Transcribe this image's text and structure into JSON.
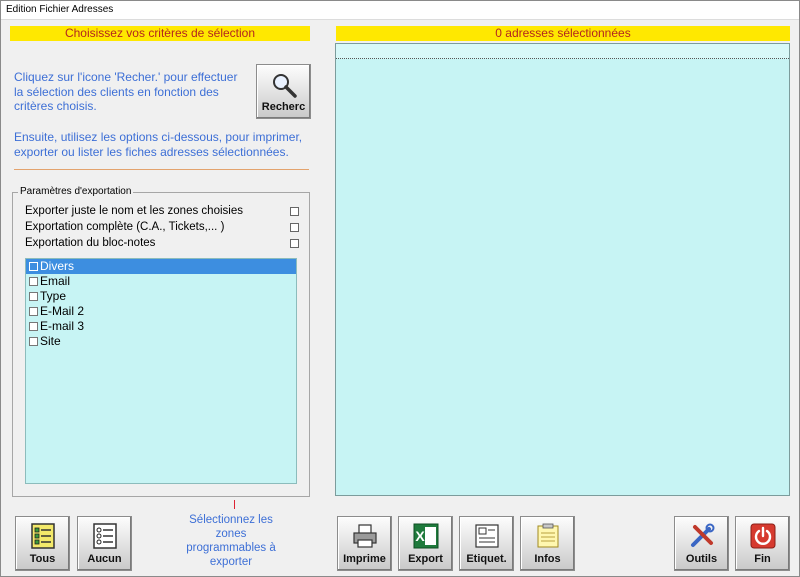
{
  "window": {
    "title": "Edition Fichier Adresses"
  },
  "left_header": "Choisissez vos critères de sélection",
  "right_header": "0 adresses sélectionnées",
  "info_search": "Cliquez sur l'icone 'Recher.' pour effectuer la sélection des clients en fonction des critères choisis.",
  "info_next": "Ensuite, utilisez les options ci-dessous, pour imprimer, exporter ou lister les fiches adresses sélectionnées.",
  "search_button_label": "Recherc",
  "params": {
    "legend": "Paramètres d'exportation",
    "options": [
      "Exporter juste le nom et les zones choisies",
      "Exportation complète (C.A., Tickets,... )",
      "Exportation du bloc-notes"
    ],
    "fields": [
      "Divers",
      "Email",
      "Type",
      "E-Mail 2",
      "E-mail 3",
      "Site"
    ]
  },
  "hint": "Sélectionnez les zones programmables à exporter",
  "buttons": {
    "tous": "Tous",
    "aucun": "Aucun",
    "imprime": "Imprime",
    "export": "Export",
    "etiquet": "Etiquet.",
    "infos": "Infos",
    "outils": "Outils",
    "fin": "Fin"
  },
  "icons": {
    "search": "magnifier-icon",
    "tous": "checklist-all-icon",
    "aucun": "checklist-none-icon",
    "imprime": "printer-icon",
    "export": "excel-icon",
    "etiquet": "label-icon",
    "infos": "notepad-icon",
    "outils": "tools-icon",
    "fin": "power-icon"
  },
  "colors": {
    "header_bg": "#ffe800",
    "header_text": "#b3261e",
    "info_text": "#3d6fd6",
    "list_bg": "#c7f4f4",
    "selection": "#3d8ee0"
  }
}
